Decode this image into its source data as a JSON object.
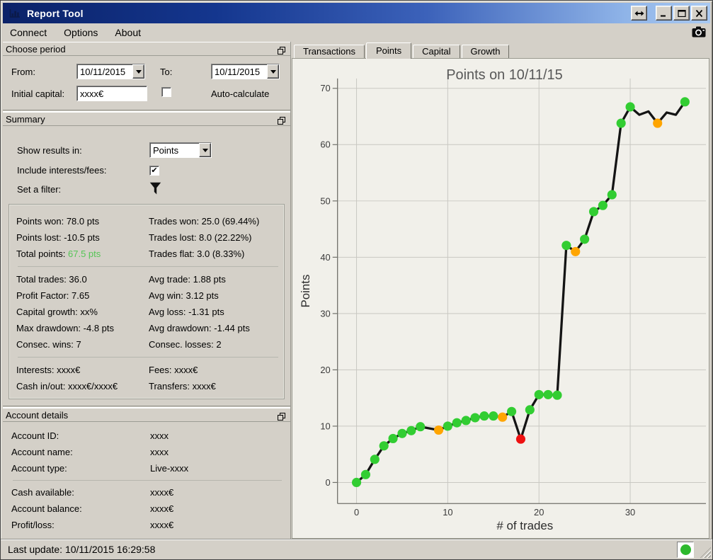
{
  "window": {
    "title": "Report Tool"
  },
  "menu": {
    "items": [
      "Connect",
      "Options",
      "About"
    ]
  },
  "choose_period": {
    "title": "Choose period",
    "from_label": "From:",
    "from_value": "10/11/2015",
    "to_label": "To:",
    "to_value": "10/11/2015",
    "initial_capital_label": "Initial capital:",
    "initial_capital_value": "xxxx€",
    "auto_calculate_checked": false,
    "auto_calculate_label": "Auto-calculate"
  },
  "summary": {
    "title": "Summary",
    "show_results_label": "Show results in:",
    "show_results_value": "Points",
    "include_fees_label": "Include interests/fees:",
    "include_fees_checked": true,
    "filter_label": "Set a filter:",
    "stats": [
      {
        "left": {
          "text": "Points won: 78.0 pts"
        },
        "right": {
          "text": "Trades won: 25.0 (69.44%)"
        }
      },
      {
        "left": {
          "text": "Points lost: -10.5 pts"
        },
        "right": {
          "text": "Trades lost: 8.0 (22.22%)"
        }
      },
      {
        "left": {
          "text": "Total points: ",
          "value": "67.5 pts",
          "value_color": "#56c556"
        },
        "right": {
          "text": "Trades flat: 3.0 (8.33%)"
        }
      },
      {
        "separator": true
      },
      {
        "left": {
          "text": "Total trades: 36.0"
        },
        "right": {
          "text": "Avg trade: 1.88 pts"
        }
      },
      {
        "left": {
          "text": "Profit Factor: 7.65"
        },
        "right": {
          "text": "Avg win: 3.12 pts"
        }
      },
      {
        "left": {
          "text": "Capital growth: xx%"
        },
        "right": {
          "text": "Avg loss: -1.31 pts"
        }
      },
      {
        "left": {
          "text": "Max drawdown: -4.8 pts"
        },
        "right": {
          "text": "Avg drawdown: -1.44 pts"
        }
      },
      {
        "left": {
          "text": "Consec. wins: 7"
        },
        "right": {
          "text": "Consec. losses: 2"
        }
      },
      {
        "separator": true
      },
      {
        "left": {
          "text": "Interests: xxxx€"
        },
        "right": {
          "text": "Fees: xxxx€"
        }
      },
      {
        "left": {
          "text": "Cash in/out: xxxx€/xxxx€"
        },
        "right": {
          "text": "Transfers: xxxx€"
        }
      }
    ]
  },
  "account": {
    "title": "Account details",
    "rows": [
      {
        "label": "Account ID:",
        "value": "xxxx"
      },
      {
        "label": "Account name:",
        "value": "xxxx"
      },
      {
        "label": "Account type:",
        "value": "Live-xxxx"
      },
      {
        "separator": true
      },
      {
        "label": "Cash available:",
        "value": "xxxx€"
      },
      {
        "label": "Account balance:",
        "value": "xxxx€"
      },
      {
        "label": "Profit/loss:",
        "value": "xxxx€"
      }
    ]
  },
  "status_bar": {
    "last_update": "Last update: 10/11/2015 16:29:58",
    "indicator_color": "#2db92d"
  },
  "tabs": [
    {
      "label": "Transactions",
      "active": false
    },
    {
      "label": "Points",
      "active": true
    },
    {
      "label": "Capital",
      "active": false
    },
    {
      "label": "Growth",
      "active": false
    }
  ],
  "chart_data": {
    "type": "line",
    "title": "Points on 10/11/15",
    "xlabel": "# of trades",
    "ylabel": "Points",
    "xticks": [
      0,
      10,
      20,
      30
    ],
    "yticks": [
      0,
      10,
      20,
      30,
      40,
      50,
      60,
      70
    ],
    "xlim": [
      -2,
      38
    ],
    "ylim": [
      -3.5,
      73
    ],
    "grid": true,
    "legend": "none",
    "x": [
      0,
      1,
      2,
      3,
      4,
      5,
      6,
      7,
      8,
      9,
      10,
      11,
      12,
      13,
      14,
      15,
      16,
      17,
      18,
      19,
      20,
      21,
      22,
      23,
      24,
      25,
      26,
      27,
      28,
      29,
      30,
      31,
      32,
      33,
      34,
      35,
      36
    ],
    "y": [
      0,
      1.4,
      4.1,
      6.5,
      7.8,
      8.7,
      9.2,
      9.9,
      9.6,
      9.3,
      10.0,
      10.6,
      11.0,
      11.5,
      11.8,
      11.8,
      11.6,
      12.6,
      7.7,
      12.9,
      15.6,
      15.6,
      15.5,
      42.1,
      41.0,
      43.2,
      48.1,
      49.2,
      51.1,
      63.8,
      66.7,
      65.3,
      65.9,
      63.8,
      65.7,
      65.3,
      67.6
    ],
    "markers": [
      "win",
      "win",
      "win",
      "win",
      "win",
      "win",
      "win",
      "win",
      null,
      "caution",
      "win",
      "win",
      "win",
      "win",
      "win",
      "win",
      "caution",
      "win",
      "loss",
      "win",
      "win",
      "win",
      "win",
      "win",
      "caution",
      "win",
      "win",
      "win",
      "win",
      "win",
      "win",
      null,
      null,
      "caution",
      null,
      null,
      "win"
    ],
    "marker_colors": {
      "win": "#32cd32",
      "caution": "#ffa500",
      "loss": "#ee1111"
    },
    "line_color": "#141414",
    "background": "#f1f0ea"
  }
}
